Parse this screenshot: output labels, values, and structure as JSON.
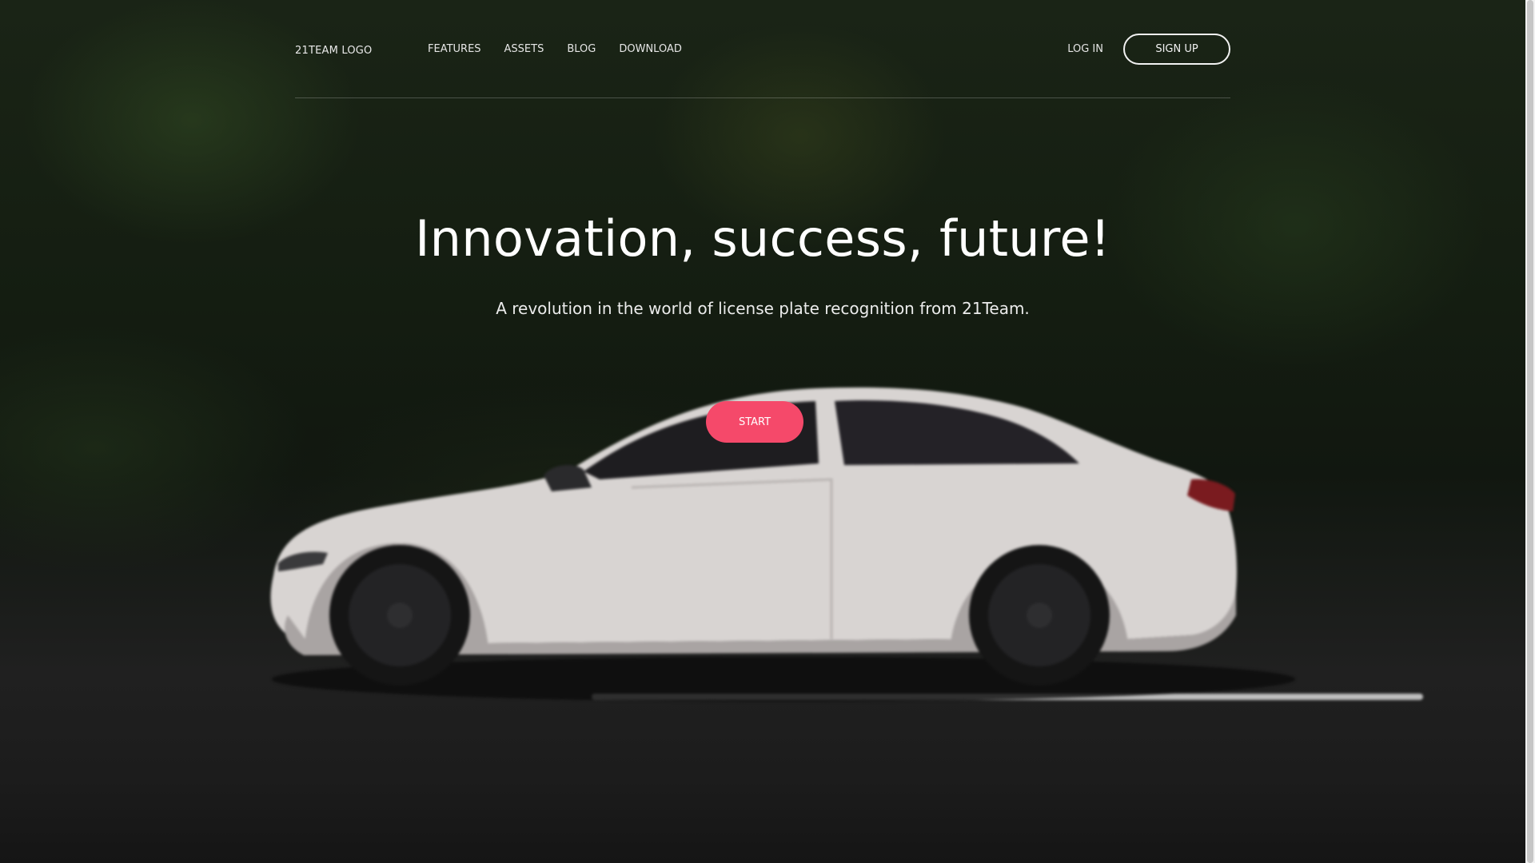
{
  "header": {
    "logo": "21TEAM LOGO",
    "nav": [
      {
        "label": "FEATURES"
      },
      {
        "label": "ASSETS"
      },
      {
        "label": "BLOG"
      },
      {
        "label": "DOWNLOAD"
      }
    ],
    "login_label": "LOG IN",
    "signup_label": "SIGN UP"
  },
  "hero": {
    "title": "Innovation, success, future!",
    "subtitle": "A revolution in the world of license plate recognition from 21Team.",
    "start_label": "START"
  },
  "colors": {
    "accent": "#f5496a",
    "car_body": "#d8d4d2",
    "background_dark": "#111710"
  }
}
